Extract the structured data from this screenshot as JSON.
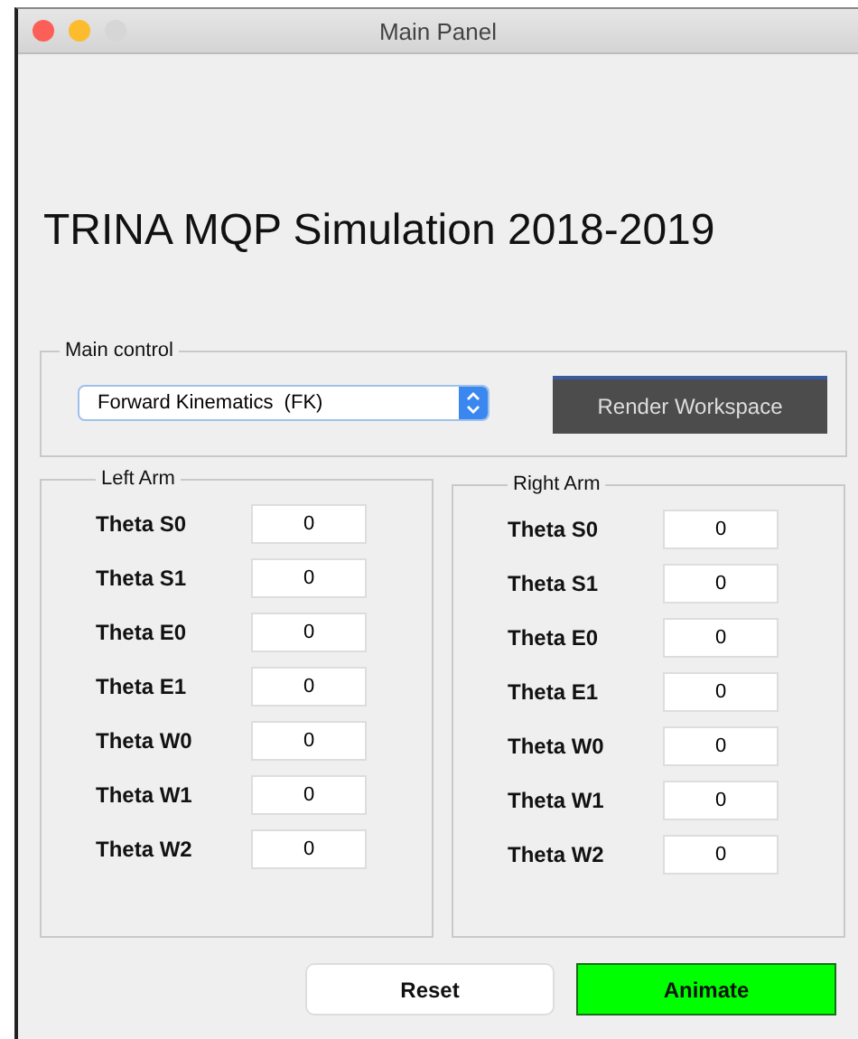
{
  "window": {
    "title": "Main Panel"
  },
  "heading": "TRINA MQP Simulation 2018-2019",
  "main_control": {
    "legend": "Main control",
    "mode_select": "Forward Kinematics  (FK)",
    "render_button": "Render Workspace"
  },
  "arms": [
    {
      "legend": "Left Arm",
      "joints": [
        {
          "label": "Theta S0",
          "value": "0"
        },
        {
          "label": "Theta S1",
          "value": "0"
        },
        {
          "label": "Theta E0",
          "value": "0"
        },
        {
          "label": "Theta E1",
          "value": "0"
        },
        {
          "label": "Theta W0",
          "value": "0"
        },
        {
          "label": "Theta W1",
          "value": "0"
        },
        {
          "label": "Theta W2",
          "value": "0"
        }
      ]
    },
    {
      "legend": "Right Arm",
      "joints": [
        {
          "label": "Theta S0",
          "value": "0"
        },
        {
          "label": "Theta S1",
          "value": "0"
        },
        {
          "label": "Theta E0",
          "value": "0"
        },
        {
          "label": "Theta E1",
          "value": "0"
        },
        {
          "label": "Theta W0",
          "value": "0"
        },
        {
          "label": "Theta W1",
          "value": "0"
        },
        {
          "label": "Theta W2",
          "value": "0"
        }
      ]
    }
  ],
  "buttons": [
    {
      "label": "Reset",
      "kind": "plain"
    },
    {
      "label": "Animate",
      "kind": "primary"
    }
  ]
}
